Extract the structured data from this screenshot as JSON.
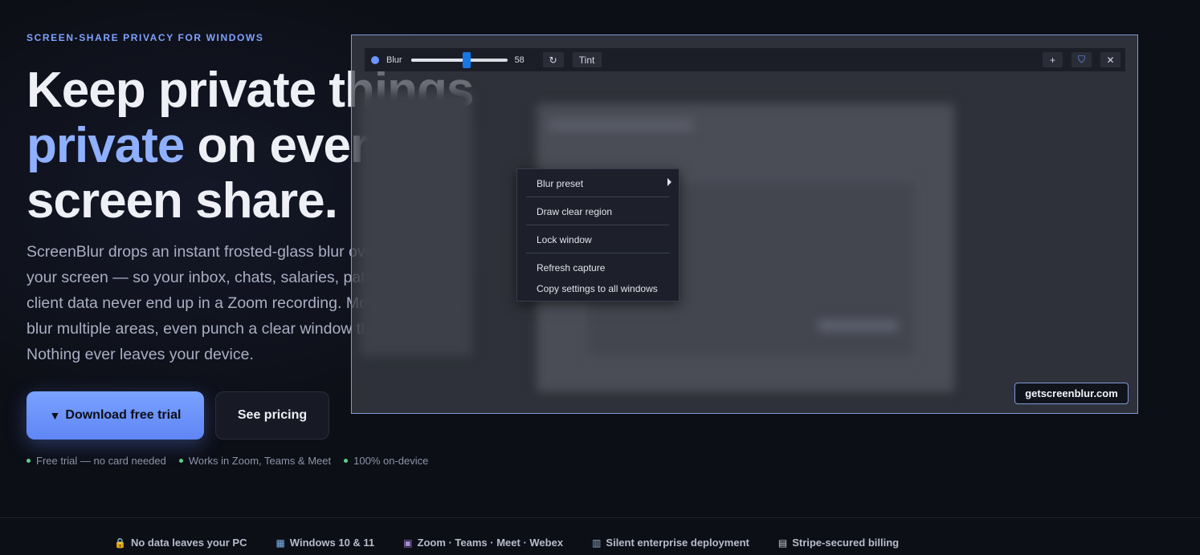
{
  "hero": {
    "eyebrow": "SCREEN-SHARE PRIVACY FOR WINDOWS",
    "headline_line1": "Keep private things",
    "headline_accent": "private",
    "headline_line2_rest": " on every",
    "headline_line3": "screen share.",
    "subtext": "ScreenBlur drops an instant frosted-glass blur over any part of your screen — so your inbox, chats, salaries, patient details or client data never end up in a Zoom recording. Move it, resize it, blur multiple areas, even punch a clear window through it. Nothing ever leaves your device.",
    "primary_cta": "Download free trial",
    "secondary_cta": "See pricing",
    "checks": [
      "Free trial — no card needed",
      "Works in Zoom, Teams & Meet",
      "100% on-device"
    ]
  },
  "overlay_app": {
    "toolbar": {
      "mode_label": "Blur",
      "blur_value": 58,
      "blur_value_text": "58",
      "tint_label": "Tint",
      "refresh_glyph": "↻",
      "add_glyph": "+",
      "shield_glyph": "⛉",
      "close_glyph": "✕"
    },
    "context_menu": {
      "items": [
        "Blur preset",
        "Draw clear region",
        "Lock window",
        "Refresh capture",
        "Copy settings to all windows"
      ]
    },
    "url_badge": "getscreenblur.com"
  },
  "trust_bar": [
    {
      "icon": "lock-icon",
      "glyph": "🔒",
      "label": "No data leaves your PC"
    },
    {
      "icon": "windows-icon",
      "glyph": "▦",
      "label": "Windows 10 & 11"
    },
    {
      "icon": "video-icon",
      "glyph": "▣",
      "label": "Zoom · Teams · Meet · Webex"
    },
    {
      "icon": "building-icon",
      "glyph": "▥",
      "label": "Silent enterprise deployment"
    },
    {
      "icon": "receipt-icon",
      "glyph": "▤",
      "label": "Stripe-secured billing"
    }
  ],
  "colors": {
    "background": "#0d0f17",
    "accent": "#7ea2ff",
    "primary_button": "#6b93fa",
    "check_dot": "#5fd08a",
    "overlay_border": "#7e9ad6",
    "slider_thumb": "#1677e8"
  }
}
